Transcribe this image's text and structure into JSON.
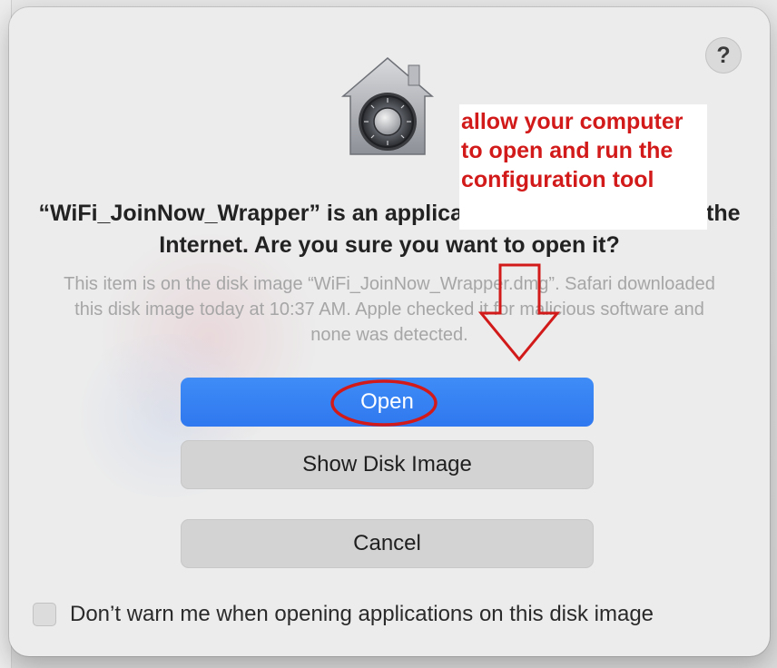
{
  "dialog": {
    "help_label": "?",
    "title": "“WiFi_JoinNow_Wrapper” is an application downloaded from the Internet. Are you sure you want to open it?",
    "message": "This item is on the disk image “WiFi_JoinNow_Wrapper.dmg”. Safari downloaded this disk image today at 10:37 AM. Apple checked it for malicious software and none was detected.",
    "open_label": "Open",
    "show_disk_image_label": "Show Disk Image",
    "cancel_label": "Cancel",
    "checkbox_label": "Don’t warn me when opening applications on this disk image",
    "checkbox_checked": false,
    "icon": "gatekeeper-vault-icon"
  },
  "annotation": {
    "text": "allow your computer to open and run the configuration tool",
    "color": "#d21a1a"
  },
  "colors": {
    "primary_button": "#3b82f6",
    "secondary_button": "#d3d3d3",
    "annotation_red": "#d21a1a"
  }
}
